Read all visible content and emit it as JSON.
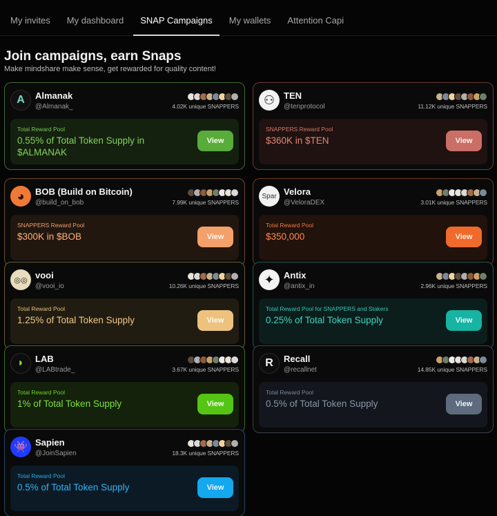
{
  "tabs": [
    {
      "label": "My invites",
      "active": false
    },
    {
      "label": "My dashboard",
      "active": false
    },
    {
      "label": "SNAP Campaigns",
      "active": true
    },
    {
      "label": "My wallets",
      "active": false
    },
    {
      "label": "Attention Capi",
      "active": false
    }
  ],
  "header": {
    "title": "Join campaigns, earn Snaps",
    "subtitle": "Make mindshare make sense, get rewarded for quality content!"
  },
  "campaigns": [
    {
      "name": "Almanak",
      "handle": "@Almanak_",
      "logo_icon": "almanak-logo",
      "logo_text": "A",
      "snappers": "4.02K unique SNAPPERS",
      "pool_label": "Total Reward Pool",
      "pool_value": "0.55% of Total Token Supply in $ALMANAK",
      "button": "View",
      "theme": {
        "border": "#3d6b2c",
        "pool_bg": "#14210f",
        "label": "#7cc25a",
        "value": "#86d15f",
        "btn": "#59ab3b",
        "btn_text": "#f2ffe8"
      }
    },
    {
      "name": "TEN",
      "handle": "@tenprotocol",
      "logo_icon": "ten-logo",
      "logo_text": "⚇",
      "snappers": "11.12K unique SNAPPERS",
      "pool_label": "SNAPPERS Reward Pool",
      "pool_value": "$360K in $TEN",
      "button": "View",
      "theme": {
        "border": "#6b3b33",
        "pool_bg": "#1f1210",
        "label": "#d6776b",
        "value": "#e7867a",
        "btn": "#c96f66",
        "btn_text": "#fff0ee"
      }
    },
    {
      "name": "BOB (Build on Bitcoin)",
      "handle": "@build_on_bob",
      "logo_icon": "bob-logo",
      "logo_text": "◕",
      "snappers": "7.99K unique SNAPPERS",
      "pool_label": "SNAPPERS Reward Pool",
      "pool_value": "$300K in $BOB",
      "button": "View",
      "theme": {
        "border": "#6b4a2c",
        "pool_bg": "#21170f",
        "label": "#f0a070",
        "value": "#ffb27d",
        "btn": "#f3a06b",
        "btn_text": "#fff4ec"
      }
    },
    {
      "name": "Velora",
      "handle": "@VeloraDEX",
      "logo_icon": "velora-logo",
      "logo_text": "Spar",
      "snappers": "3.01K unique SNAPPERS",
      "pool_label": "Total Reward Pool",
      "pool_value": "$350,000",
      "button": "View",
      "theme": {
        "border": "#6b3a22",
        "pool_bg": "#21120b",
        "label": "#f07a44",
        "value": "#ff8a4f",
        "btn": "#f06a2c",
        "btn_text": "#fff0e6"
      }
    },
    {
      "name": "vooi",
      "handle": "@vooi_io",
      "logo_icon": "vooi-logo",
      "logo_text": "◎◎",
      "snappers": "10.26K unique SNAPPERS",
      "pool_label": "Total Reward Pool",
      "pool_value": "1.25% of Total Token Supply",
      "button": "View",
      "theme": {
        "border": "#6b5a36",
        "pool_bg": "#211c12",
        "label": "#e5bf7d",
        "value": "#f1c985",
        "btn": "#edc27f",
        "btn_text": "#fff8ea"
      }
    },
    {
      "name": "Antix",
      "handle": "@antix_in",
      "logo_icon": "antix-logo",
      "logo_text": "✦",
      "snappers": "2.96K unique SNAPPERS",
      "pool_label": "Total Reward Pool for SNAPPERS and Stakers",
      "pool_value": "0.25% of Total Token Supply",
      "button": "View",
      "theme": {
        "border": "#1f5a53",
        "pool_bg": "#0c1e1c",
        "label": "#35c9b8",
        "value": "#3cd6c4",
        "btn": "#17b3a3",
        "btn_text": "#e9fffc"
      }
    },
    {
      "name": "LAB",
      "handle": "@LABtrade_",
      "logo_icon": "lab-logo",
      "logo_text": "◗",
      "snappers": "3.67K unique SNAPPERS",
      "pool_label": "Total Reward Pool",
      "pool_value": "1% of Total Token Supply",
      "button": "View",
      "theme": {
        "border": "#3d6b1f",
        "pool_bg": "#14210b",
        "label": "#6fd12e",
        "value": "#7ee03a",
        "btn": "#55c514",
        "btn_text": "#f2ffe6"
      }
    },
    {
      "name": "Recall",
      "handle": "@recallnet",
      "logo_icon": "recall-logo",
      "logo_text": "R",
      "snappers": "14.85K unique SNAPPERS",
      "pool_label": "Total Reward Pool",
      "pool_value": "0.5% of Total Token Supply",
      "button": "View",
      "theme": {
        "border": "#3a4250",
        "pool_bg": "#13171d",
        "label": "#7d8796",
        "value": "#8a95a6",
        "btn": "#5e6b7e",
        "btn_text": "#eef3fa"
      }
    },
    {
      "name": "Sapien",
      "handle": "@JoinSapien",
      "logo_icon": "sapien-logo",
      "logo_text": "👾",
      "snappers": "18.3K unique SNAPPERS",
      "pool_label": "Total Reward Pool",
      "pool_value": "0.5% of Total Token Supply",
      "button": "View",
      "theme": {
        "border": "#1f4a66",
        "pool_bg": "#0b1a24",
        "label": "#2ea8e8",
        "value": "#33b3f5",
        "btn": "#14a8ee",
        "btn_text": "#eaf7ff"
      }
    }
  ],
  "avatar_colors": [
    "#e9e2d6",
    "#d9d9d9",
    "#a46b4a",
    "#c8b38f",
    "#7a8a9c",
    "#f2d39a",
    "#5b4c3c",
    "#b0b0b0",
    "#8e5b3a",
    "#c9a26a",
    "#6f7f6a",
    "#eaeaea"
  ]
}
